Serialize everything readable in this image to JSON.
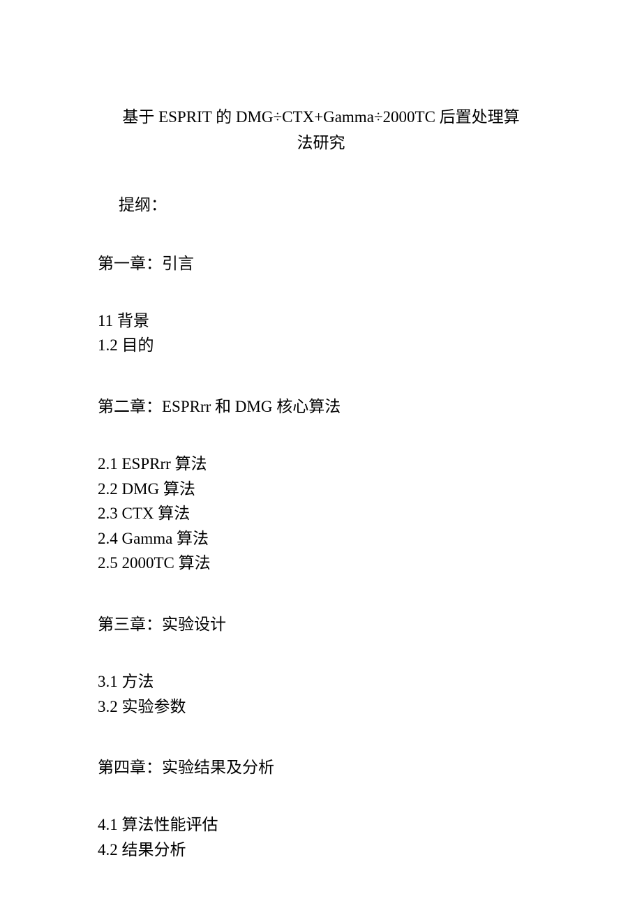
{
  "title": {
    "line1": "基于 ESPRIT 的 DMG÷CTX+Gamma÷2000TC 后置处理算",
    "line2": "法研究"
  },
  "outline_label": "提纲：",
  "chapters": {
    "ch1": {
      "heading": "第一章：引言",
      "items": [
        "11 背景",
        "1.2 目的"
      ]
    },
    "ch2": {
      "heading": "第二章：ESPRrr 和 DMG 核心算法",
      "items": [
        "2.1  ESPRrr 算法",
        "2.2   DMG 算法",
        "2.3   CTX 算法",
        "2.4   Gamma 算法",
        "2.5   2000TC 算法"
      ]
    },
    "ch3": {
      "heading": "第三章：实验设计",
      "items": [
        "3.1  方法",
        "3.2  实验参数"
      ]
    },
    "ch4": {
      "heading": "第四章：实验结果及分析",
      "items": [
        "4.1  算法性能评估",
        "4.2  结果分析"
      ]
    }
  }
}
